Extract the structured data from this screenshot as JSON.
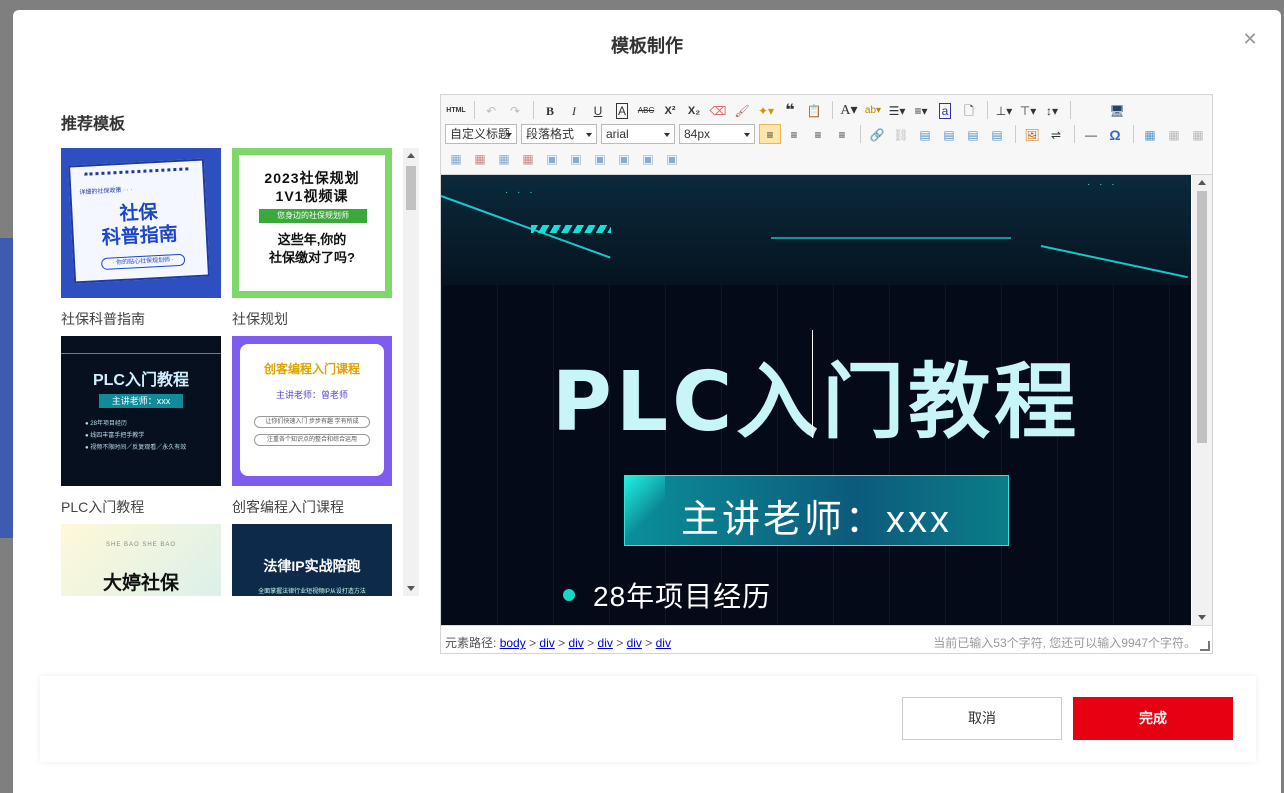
{
  "modal": {
    "title": "模板制作",
    "close_icon": "close-icon"
  },
  "templates": {
    "section_title": "推荐模板",
    "items": [
      {
        "label": "社保科普指南",
        "thumb_small": "详细的社保政策 · · ·",
        "thumb_big_1": "社保",
        "thumb_big_2": "科普指南",
        "thumb_pill": "· 你的贴心社保规划师 ·"
      },
      {
        "label": "社保规划",
        "thumb_line1": "2023社保规划",
        "thumb_line2": "1V1视频课",
        "thumb_bar": "您身边的社保规划师",
        "thumb_line3": "这些年,你的",
        "thumb_line4": "社保缴对了吗?"
      },
      {
        "label": "PLC入门教程",
        "thumb_title": "PLC入门教程",
        "thumb_sub": "主讲老师：xxx",
        "thumb_b1": "● 28年项目经历",
        "thumb_b2": "● 线四丰富手把手教学",
        "thumb_b3": "● 视频不限时间／反复观看／永久有效"
      },
      {
        "label": "创客编程入门课程",
        "thumb_title": "创客编程入门课程",
        "thumb_sub": "主讲老师：曾老师",
        "thumb_p1": "让你们快速入门 步步有趣 学有所成",
        "thumb_p2": "注重各个知识点的整合和综合运用"
      },
      {
        "label": "",
        "thumb_small": "SHE BAO SHE BAO",
        "thumb_title": "大婷社保"
      },
      {
        "label": "",
        "thumb_title": "法律IP实战陪跑",
        "thumb_sub": "全面掌握法律行业短视频IP从设打造方法"
      }
    ]
  },
  "editor": {
    "toolbar": {
      "row1": [
        "HTML",
        "undo",
        "redo",
        "B",
        "I",
        "U",
        "A",
        "ABC",
        "X²",
        "X₂",
        "eraser",
        "brush",
        "wand",
        "quote",
        "paste",
        "A",
        "ab",
        "ordered-list",
        "unordered-list",
        "a",
        "page",
        "align",
        "line-height",
        "spacing",
        "preview"
      ],
      "select_heading": "自定义标题",
      "select_paragraph": "段落格式",
      "select_font": "arial",
      "select_size": "84px",
      "omega": "Ω",
      "hr": "—"
    },
    "content": {
      "title": "PLC入门教程",
      "teacher": "主讲老师：xxx",
      "bullet": "28年项目经历",
      "dots": "· · ·"
    },
    "status": {
      "path_label": "元素路径:",
      "path": [
        "body",
        "div",
        "div",
        "div",
        "div",
        "div"
      ],
      "separator": ">",
      "count_text": "当前已输入53个字符, 您还可以输入9947个字符。"
    }
  },
  "footer": {
    "cancel": "取消",
    "confirm": "完成"
  },
  "colors": {
    "primary": "#e60012",
    "editor_bg": "#040a18",
    "accent_teal": "#1ad6c8"
  }
}
